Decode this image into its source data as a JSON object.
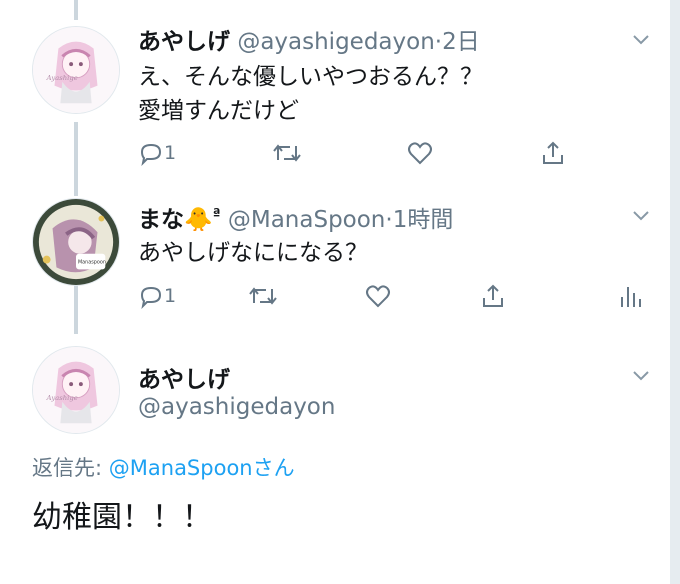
{
  "tweets": [
    {
      "name": "あやしげ",
      "handle": "@ayashigedayon",
      "time": "2日",
      "lines": [
        "え、そんな優しいやつおるん？？",
        "愛増すんだけど"
      ],
      "reply_count": "1",
      "avatar_signature": "Ayashige"
    },
    {
      "name": "まな",
      "name_emoji": "🐥",
      "name_badge": "ª",
      "handle": "@ManaSpoon",
      "time": "1時間",
      "lines": [
        "あやしげなにになる？"
      ],
      "reply_count": "1",
      "avatar_badge_text": "Manaspoon"
    }
  ],
  "main_tweet": {
    "name": "あやしげ",
    "handle": "@ayashigedayon",
    "reply_to_label": "返信先:",
    "reply_to_handle": "@ManaSpoon",
    "reply_to_suffix": "さん",
    "text": "幼稚園！！！",
    "avatar_signature": "Ayashige"
  },
  "time_separator": "·",
  "colors": {
    "text_primary": "#14171a",
    "text_secondary": "#657786",
    "link": "#1da1f2",
    "icon": "#657786",
    "thread_line": "#ccd6dd",
    "avatar_pink": "#e9b8d6"
  },
  "icons": [
    "reply-icon",
    "retweet-icon",
    "like-icon",
    "share-icon",
    "analytics-icon",
    "chevron-down-icon"
  ]
}
